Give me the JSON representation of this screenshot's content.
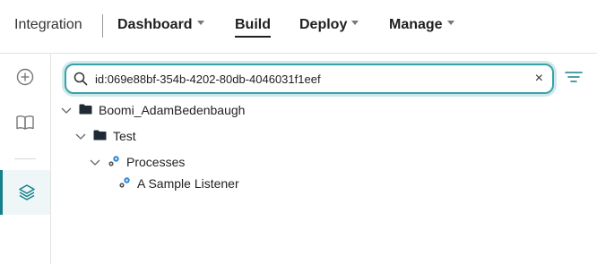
{
  "header": {
    "product": "Integration",
    "nav": [
      {
        "label": "Dashboard",
        "has_menu": true
      },
      {
        "label": "Build",
        "has_menu": false,
        "active": true
      },
      {
        "label": "Deploy",
        "has_menu": true
      },
      {
        "label": "Manage",
        "has_menu": true
      }
    ]
  },
  "sidebar": {
    "items": [
      {
        "icon": "add-circle-icon",
        "active": false
      },
      {
        "icon": "book-icon",
        "active": false
      },
      {
        "icon": "layers-icon",
        "active": true
      }
    ]
  },
  "search": {
    "value": "id:069e88bf-354b-4202-80db-4046031f1eef",
    "clear_glyph": "×"
  },
  "tree": [
    {
      "label": "Boomi_AdamBedenbaugh",
      "icon": "folder-icon",
      "expanded": true
    },
    {
      "label": "Test",
      "icon": "folder-icon",
      "expanded": true
    },
    {
      "label": "Processes",
      "icon": "process-icon",
      "expanded": true
    },
    {
      "label": "A Sample Listener",
      "icon": "process-icon",
      "expanded": false
    }
  ],
  "colors": {
    "accent": "#167f89",
    "search_border": "#39a1a8",
    "process_icon": "#2e86de"
  }
}
